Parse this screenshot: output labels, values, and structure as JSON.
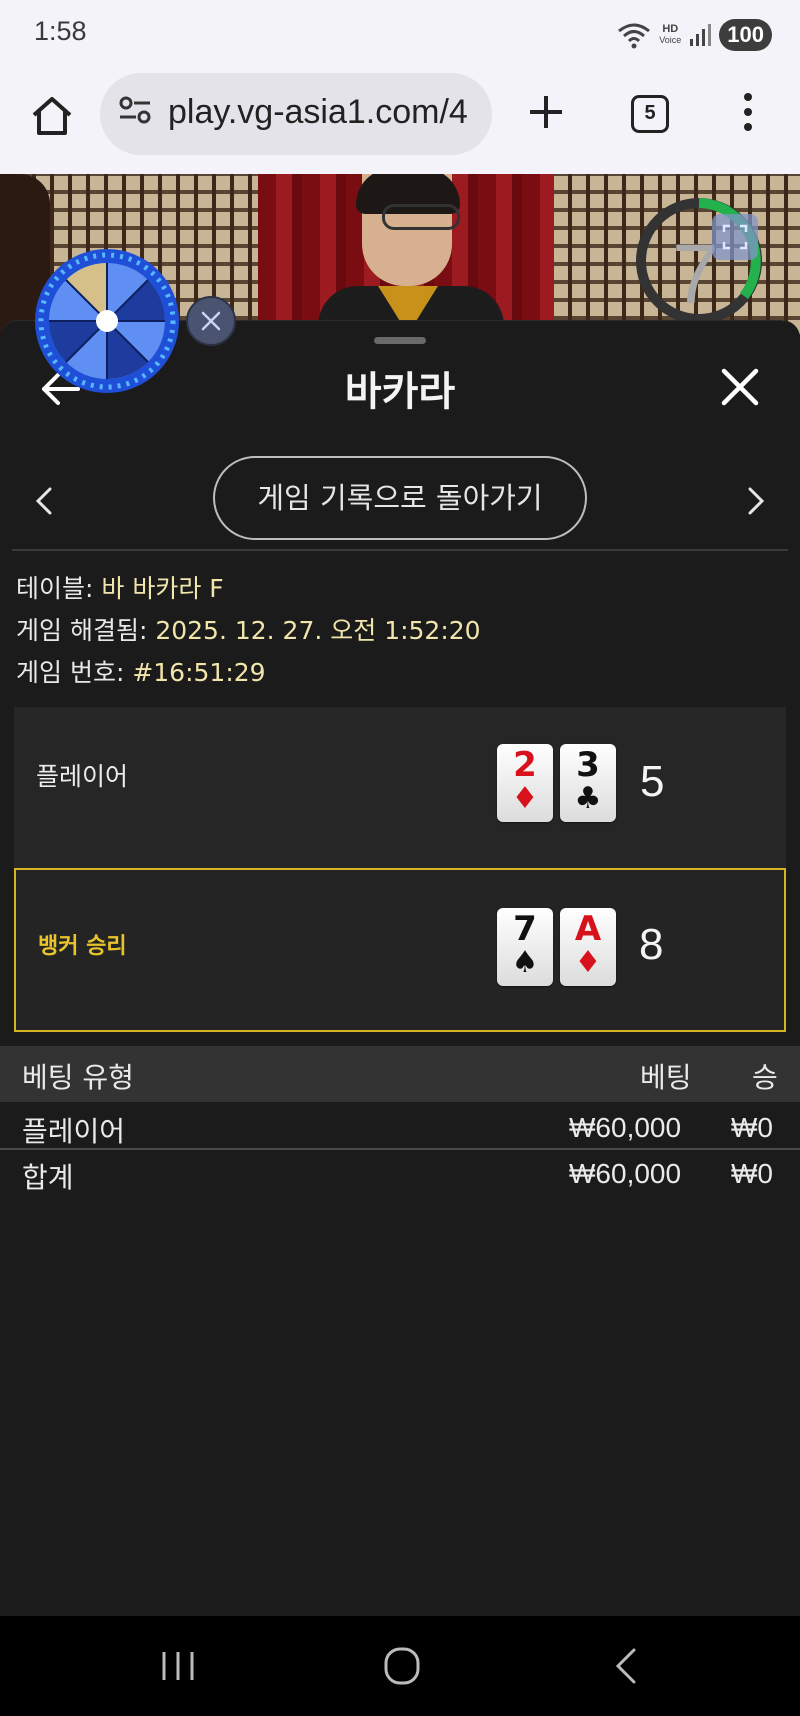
{
  "status_bar": {
    "time": "1:58",
    "hd_line1": "HD",
    "hd_line2": "Voice",
    "battery": "100"
  },
  "browser": {
    "url": "play.vg-asia1.com/4",
    "tab_count": "5"
  },
  "video": {
    "timer": "7"
  },
  "sheet": {
    "title": "바카라",
    "return_button": "게임 기록으로 돌아가기",
    "info": [
      {
        "label": "테이블: ",
        "value": "바 바카라 F"
      },
      {
        "label": "게임 해결됨: ",
        "value": "2025. 12. 27. 오전 1:52:20"
      },
      {
        "label": "게임 번호: ",
        "value": "#16:51:29"
      }
    ],
    "player": {
      "label": "플레이어",
      "cards": [
        {
          "rank": "2",
          "suit": "♦",
          "color": "red"
        },
        {
          "rank": "3",
          "suit": "♣",
          "color": "black"
        }
      ],
      "score": "5"
    },
    "banker": {
      "label": "뱅커 승리",
      "cards": [
        {
          "rank": "7",
          "suit": "♠",
          "color": "black"
        },
        {
          "rank": "A",
          "suit": "♦",
          "color": "red"
        }
      ],
      "score": "8"
    },
    "bet_table": {
      "headers": {
        "type": "베팅 유형",
        "bet": "베팅",
        "win": "승"
      },
      "rows": [
        {
          "type": "플레이어",
          "bet": "₩60,000",
          "win": "₩0"
        }
      ],
      "total": {
        "type": "합계",
        "bet": "₩60,000",
        "win": "₩0"
      }
    }
  },
  "colors": {
    "accent_gold": "#d7b421",
    "value_text": "#f1e5ab",
    "sheet_bg": "#1b1b1b"
  }
}
